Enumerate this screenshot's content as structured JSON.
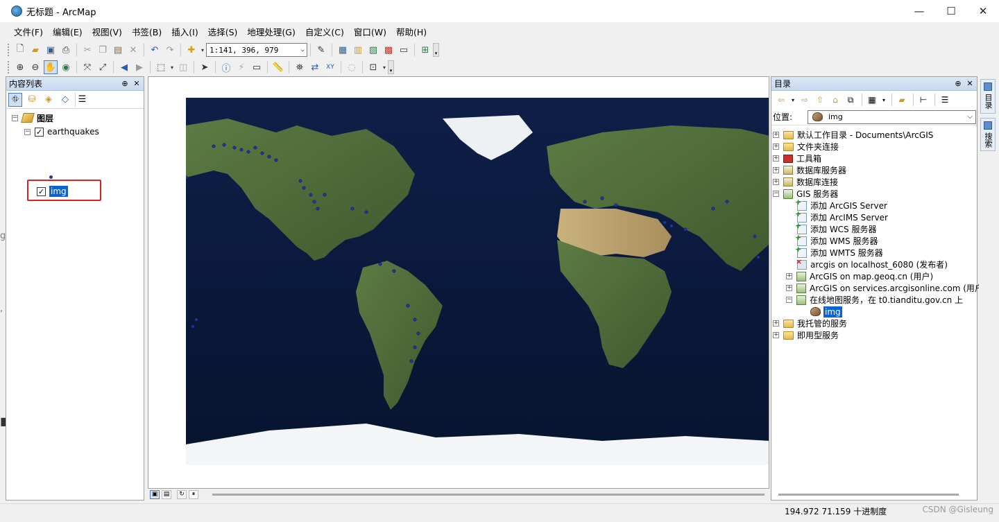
{
  "window": {
    "title": "无标题 - ArcMap",
    "controls": [
      "—",
      "☐",
      "✕"
    ]
  },
  "menu": [
    "文件(F)",
    "编辑(E)",
    "视图(V)",
    "书签(B)",
    "插入(I)",
    "选择(S)",
    "地理处理(G)",
    "自定义(C)",
    "窗口(W)",
    "帮助(H)"
  ],
  "toolbar": {
    "scale": "1:141, 396, 979"
  },
  "toc": {
    "title": "内容列表",
    "pin": "⊕",
    "close": "✕",
    "root": "图层",
    "layers": [
      {
        "name": "earthquakes",
        "checked": true
      },
      {
        "name": "img",
        "checked": true,
        "selected": true
      }
    ]
  },
  "catalog": {
    "title": "目录",
    "pin": "⊕",
    "close": "✕",
    "location_label": "位置:",
    "location_value": "img",
    "items": [
      "默认工作目录 - Documents\\ArcGIS",
      "文件夹连接",
      "工具箱",
      "数据库服务器",
      "数据库连接",
      "GIS 服务器",
      "添加 ArcGIS Server",
      "添加 ArcIMS Server",
      "添加 WCS 服务器",
      "添加 WMS 服务器",
      "添加 WMTS 服务器",
      "arcgis on localhost_6080 (发布者)",
      "ArcGIS on map.geoq.cn (用户)",
      "ArcGIS on services.arcgisonline.com (用户",
      "在线地图服务，在 t0.tianditu.gov.cn 上",
      "img",
      "我托管的服务",
      "即用型服务"
    ]
  },
  "dock": {
    "tab1": "目录",
    "tab2": "搜索"
  },
  "statusbar": {
    "coordinates": "194.972  71.159 十进制度",
    "watermark": "CSDN @Gisleung"
  },
  "colors": {
    "ocean": "#0b1a3d",
    "land": "#4f6b3a",
    "ice": "#e8ecf0",
    "quake": "#2036a6",
    "selection": "#0a64d6",
    "highlight_box": "#e02020"
  }
}
